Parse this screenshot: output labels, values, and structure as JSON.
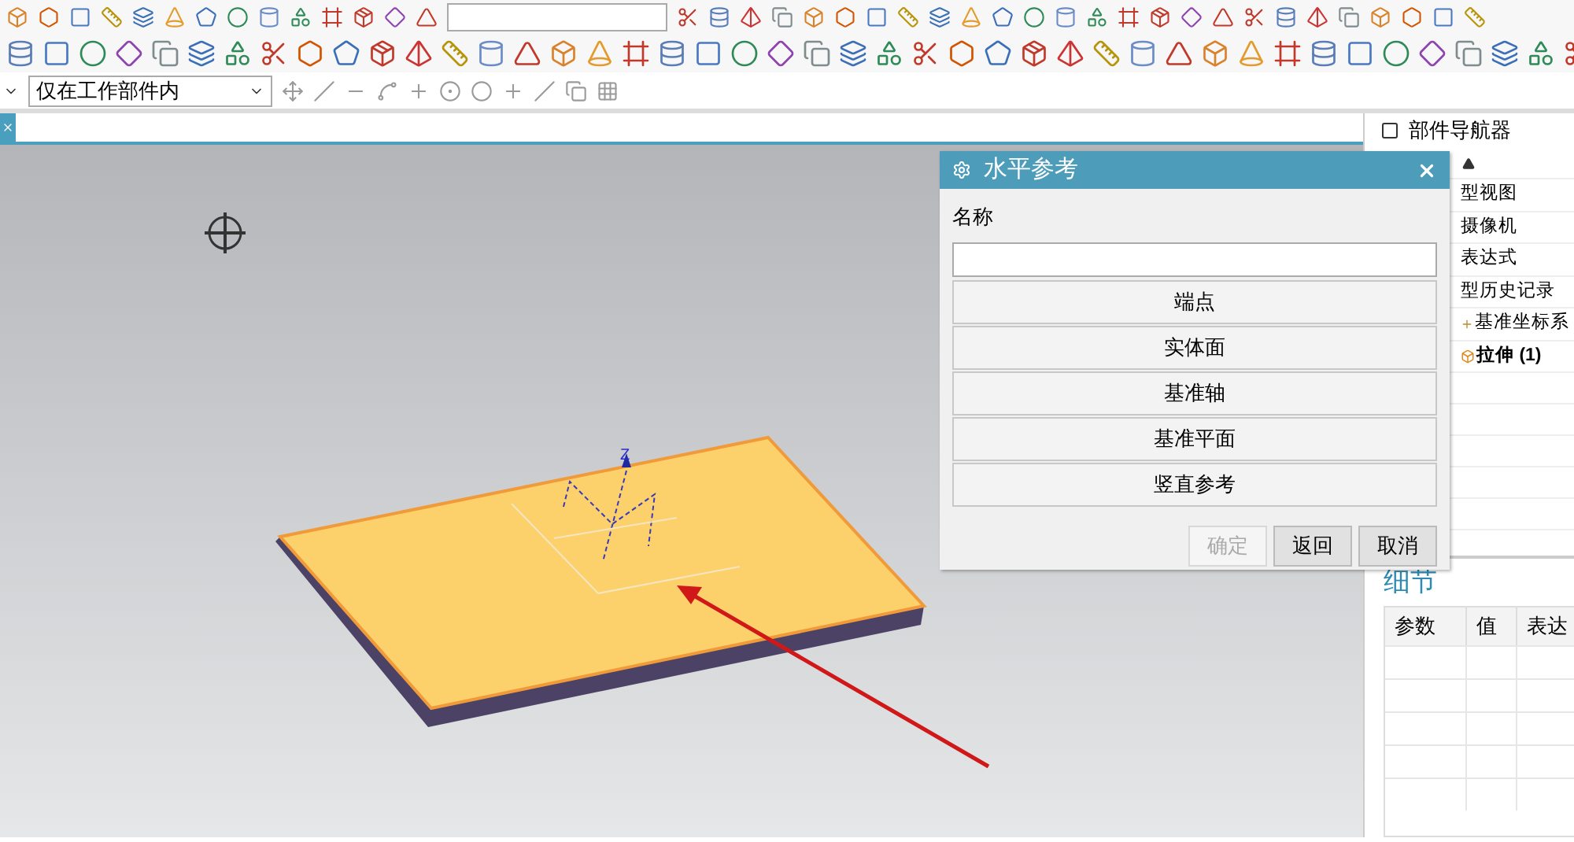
{
  "toolbar": {
    "filter_dropdown": {
      "value": "仅在工作部件内"
    }
  },
  "viewport": {
    "axis_label": "Z"
  },
  "dialog": {
    "title": "水平参考",
    "name_label": "名称",
    "buttons": [
      "端点",
      "实体面",
      "基准轴",
      "基准平面",
      "竖直参考"
    ],
    "footer_buttons": [
      {
        "label": "确定",
        "disabled": true
      },
      {
        "label": "返回",
        "disabled": false
      },
      {
        "label": "取消",
        "disabled": false
      }
    ]
  },
  "part_navigator": {
    "title": "部件导航器",
    "tree": [
      {
        "label": "型视图",
        "kind": "node",
        "current": false
      },
      {
        "label": "摄像机",
        "kind": "node",
        "current": false
      },
      {
        "label": "表达式",
        "kind": "node",
        "current": false
      },
      {
        "label": "型历史记录",
        "kind": "node",
        "current": false
      },
      {
        "label": "基准坐标系",
        "kind": "datum",
        "current": false
      },
      {
        "label": "拉伸 (1)",
        "kind": "extrude",
        "current": true
      }
    ]
  },
  "details": {
    "title": "细节",
    "columns": [
      "参数",
      "值",
      "表达"
    ]
  }
}
